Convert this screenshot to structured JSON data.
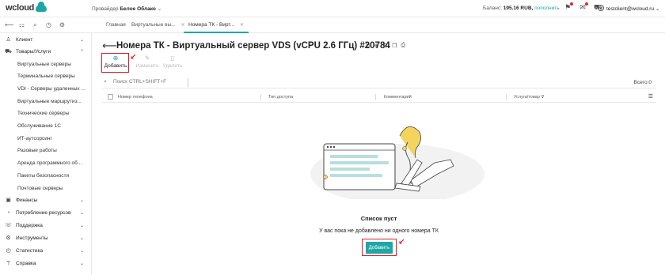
{
  "brand": {
    "logo": "wcloud"
  },
  "header": {
    "provider_label": "Провайдер",
    "provider_value": "Белое Облако",
    "balance_label": "Баланс:",
    "balance_value": "195.16 RUB,",
    "topup_link": "пополнить",
    "user_email": "testclient@wcloud.ru",
    "colors": {
      "accent": "#1fa6a6",
      "alert": "#d81f26"
    }
  },
  "tabs": [
    {
      "label": "Главная"
    },
    {
      "label": "Виртуальные вы..."
    },
    {
      "label": "Номера ТК - Вирт..."
    }
  ],
  "sidebar": {
    "items": [
      {
        "label": "Клиент",
        "icon": "user-icon"
      },
      {
        "label": "Товары/Услуги",
        "icon": "cart-icon"
      },
      {
        "label": "Финансы",
        "icon": "wallet-icon"
      },
      {
        "label": "Потребление ресурсов",
        "icon": "pie-icon"
      },
      {
        "label": "Поддержка",
        "icon": "support-icon"
      },
      {
        "label": "Инструменты",
        "icon": "gear-icon"
      },
      {
        "label": "Статистика",
        "icon": "stats-icon"
      },
      {
        "label": "Справка",
        "icon": "help-icon"
      }
    ],
    "subitems": [
      "Виртуальные серверы",
      "Терминальные серверы",
      "VDI - Серверы удаленных ...",
      "Виртуальные маршрутиз...",
      "Технические серверы",
      "Обслуживание 1С",
      "ИТ-аутсорсинг",
      "Разовые работы",
      "Аренда программного об...",
      "Пакеты безопасности",
      "Почтовые серверы"
    ]
  },
  "page": {
    "title": "Номера ТК - Виртуальный сервер VDS (vCPU 2.6 ГГц) #20784"
  },
  "toolbar": {
    "add_label": "Добавить",
    "edit_label": "Изменить",
    "delete_label": "Удалить"
  },
  "search": {
    "placeholder": "Поиск CTRL+SHIFT+F",
    "count_label": "Всего:",
    "count_value": "0"
  },
  "table": {
    "columns": [
      "Номер телефона",
      "Тип доступа",
      "Комментарий",
      "Услуга/товар"
    ]
  },
  "empty": {
    "title": "Список пуст",
    "description": "У вас пока не добавлено ни одного номера ТК",
    "button_label": "Добавить"
  }
}
